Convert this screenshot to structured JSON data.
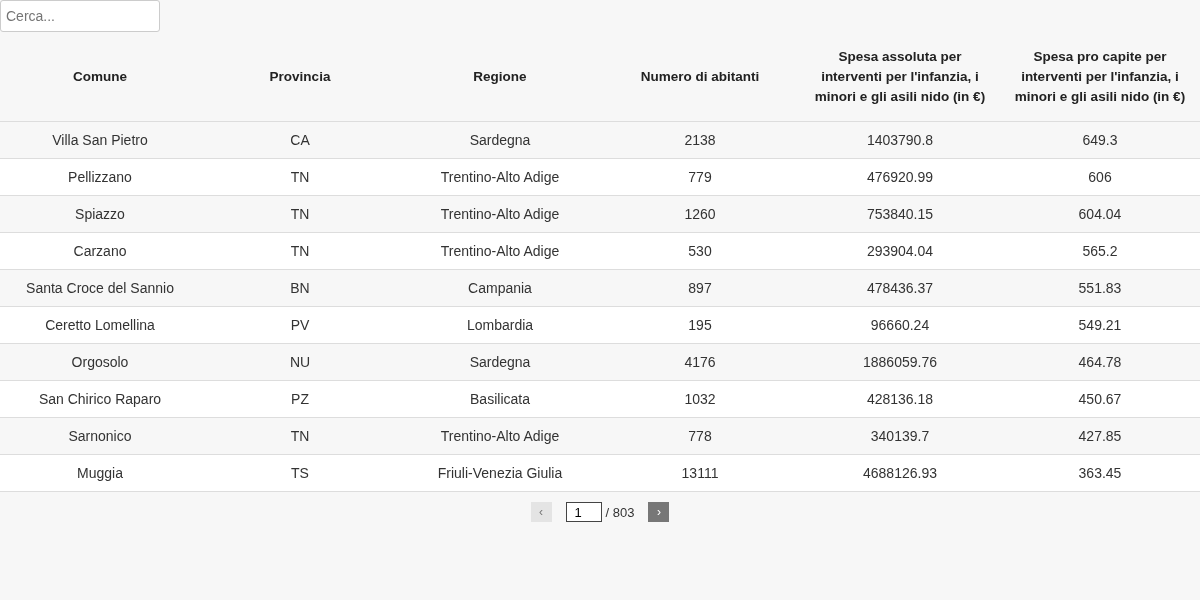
{
  "search": {
    "placeholder": "Cerca..."
  },
  "table": {
    "columns": [
      "Comune",
      "Provincia",
      "Regione",
      "Numero di abitanti",
      "Spesa assoluta per interventi per l'infanzia, i minori e gli asili nido (in €)",
      "Spesa pro capite per interventi per l'infanzia, i minori e gli asili nido (in €)"
    ],
    "rows": [
      [
        "Villa San Pietro",
        "CA",
        "Sardegna",
        "2138",
        "1403790.8",
        "649.3"
      ],
      [
        "Pellizzano",
        "TN",
        "Trentino-Alto Adige",
        "779",
        "476920.99",
        "606"
      ],
      [
        "Spiazzo",
        "TN",
        "Trentino-Alto Adige",
        "1260",
        "753840.15",
        "604.04"
      ],
      [
        "Carzano",
        "TN",
        "Trentino-Alto Adige",
        "530",
        "293904.04",
        "565.2"
      ],
      [
        "Santa Croce del Sannio",
        "BN",
        "Campania",
        "897",
        "478436.37",
        "551.83"
      ],
      [
        "Ceretto Lomellina",
        "PV",
        "Lombardia",
        "195",
        "96660.24",
        "549.21"
      ],
      [
        "Orgosolo",
        "NU",
        "Sardegna",
        "4176",
        "1886059.76",
        "464.78"
      ],
      [
        "San Chirico Raparo",
        "PZ",
        "Basilicata",
        "1032",
        "428136.18",
        "450.67"
      ],
      [
        "Sarnonico",
        "TN",
        "Trentino-Alto Adige",
        "778",
        "340139.7",
        "427.85"
      ],
      [
        "Muggia",
        "TS",
        "Friuli-Venezia Giulia",
        "13111",
        "4688126.93",
        "363.45"
      ]
    ]
  },
  "pagination": {
    "prev": {
      "label": "‹",
      "disabled": true
    },
    "page": "1",
    "total": "/ 803",
    "next": {
      "label": "›",
      "disabled": false
    }
  }
}
